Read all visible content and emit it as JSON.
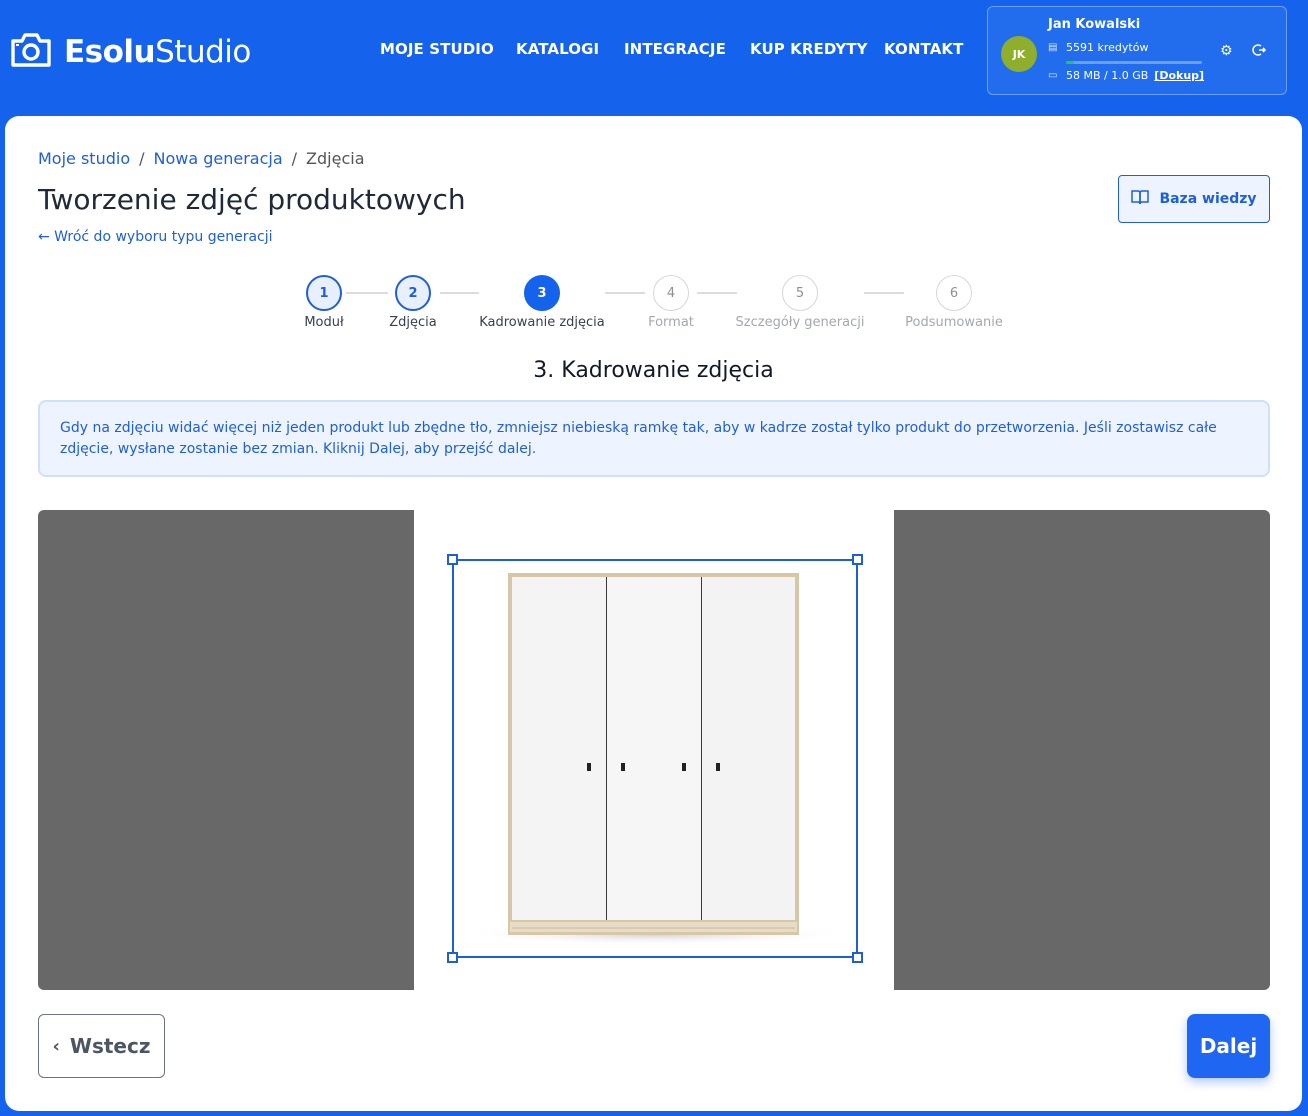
{
  "brand": {
    "name_bold": "Esolu",
    "name_regular": "Studio"
  },
  "nav": {
    "items": [
      "MOJE STUDIO",
      "KATALOGI",
      "INTEGRACJE",
      "KUP KREDYTY",
      "KONTAKT"
    ]
  },
  "user": {
    "initials": "JK",
    "name": "Jan Kowalski",
    "credits": "5591 kredytów",
    "storage": "58 MB / 1.0 GB",
    "topup": "[Dokup]",
    "storage_usage_fraction": 0.057,
    "avatar_color": "#8fae2c"
  },
  "breadcrumb": {
    "items": [
      "Moje studio",
      "Nowa generacja",
      "Zdjęcia"
    ],
    "separator": "/"
  },
  "page": {
    "title": "Tworzenie zdjęć produktowych",
    "back_link": "← Wróć do wyboru typu generacji",
    "knowledge_base": "Baza wiedzy"
  },
  "stepper": {
    "current": 3,
    "steps": [
      {
        "number": "1",
        "label": "Moduł",
        "state": "done"
      },
      {
        "number": "2",
        "label": "Zdjęcia",
        "state": "done"
      },
      {
        "number": "3",
        "label": "Kadrowanie zdjęcia",
        "state": "active"
      },
      {
        "number": "4",
        "label": "Format",
        "state": "pending"
      },
      {
        "number": "5",
        "label": "Szczegóły generacji",
        "state": "pending"
      },
      {
        "number": "6",
        "label": "Podsumowanie",
        "state": "pending"
      }
    ]
  },
  "section": {
    "title": "3. Kadrowanie zdjęcia",
    "info": "Gdy na zdjęciu widać więcej niż jeden produkt lub zbędne tło, zmniejsz niebieską ramkę tak, aby w kadrze został tylko produkt do przetworzenia. Jeśli zostawisz całe zdjęcie, wysłane zostanie bez zmian. Kliknij Dalej, aby przejść dalej."
  },
  "actions": {
    "back": "Wstecz",
    "next": "Dalej"
  },
  "colors": {
    "primary": "#1563ed",
    "accent": "#1e5fd8",
    "shade": "#686868"
  },
  "icons": {
    "logo": "camera-icon",
    "knowledge_base": "book-icon",
    "credits": "coins-icon",
    "storage": "hard-drive-icon",
    "settings": "gear-icon",
    "logout": "logout-icon",
    "back": "chevron-left-icon"
  }
}
